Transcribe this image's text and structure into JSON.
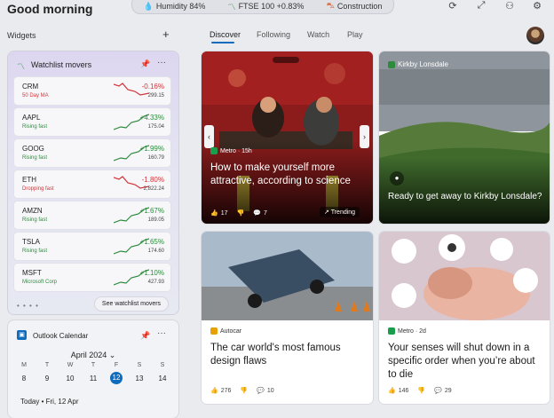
{
  "greeting": "Good morning",
  "ticker": [
    {
      "icon": "water-drop-icon",
      "label": "Humidity 84%"
    },
    {
      "icon": "trend-icon",
      "label": "FTSE 100 +0.83%"
    },
    {
      "icon": "construction-icon",
      "label": "Construction"
    }
  ],
  "widgets_label": "Widgets",
  "add_label": "+",
  "nav": [
    "Discover",
    "Following",
    "Watch",
    "Play"
  ],
  "watchlist": {
    "title": "Watchlist movers",
    "see_more": "See watchlist movers",
    "dots": "• • • •",
    "stocks": [
      {
        "symbol": "CRM",
        "sub": "50 Day MA",
        "change": "-0.16%",
        "price": "299.15",
        "trend": "down"
      },
      {
        "symbol": "AAPL",
        "sub": "Rising fast",
        "change": "+4.33%",
        "price": "175.04",
        "trend": "up"
      },
      {
        "symbol": "GOOG",
        "sub": "Rising fast",
        "change": "+1.99%",
        "price": "160.79",
        "trend": "up"
      },
      {
        "symbol": "ETH",
        "sub": "Dropping fast",
        "change": "-1.80%",
        "price": "2,822.24",
        "trend": "down"
      },
      {
        "symbol": "AMZN",
        "sub": "Rising fast",
        "change": "+1.67%",
        "price": "189.05",
        "trend": "up"
      },
      {
        "symbol": "TSLA",
        "sub": "Rising fast",
        "change": "+1.65%",
        "price": "174.60",
        "trend": "up"
      },
      {
        "symbol": "MSFT",
        "sub": "Microsoft Corp",
        "change": "+1.10%",
        "price": "427.93",
        "trend": "up"
      }
    ]
  },
  "calendar": {
    "title": "Outlook Calendar",
    "month": "April 2024",
    "days_of_week": [
      "M",
      "T",
      "W",
      "T",
      "F",
      "S",
      "S"
    ],
    "dates": [
      "8",
      "9",
      "10",
      "11",
      "12",
      "13",
      "14"
    ],
    "selected": "12",
    "today": "Today • Fri, 12 Apr"
  },
  "articles": [
    {
      "source": "Metro · 15h",
      "headline": "How to make yourself more attractive, according to science",
      "likes": "17",
      "comments": "7",
      "badge": "Trending"
    },
    {
      "source": "Kirkby Lonsdale",
      "headline": "Ready to get away to Kirkby Lonsdale?"
    },
    {
      "source": "Autocar",
      "headline": "The car world's most famous design flaws",
      "likes": "276",
      "comments": "10"
    },
    {
      "source": "Metro · 2d",
      "headline": "Your senses will shut down in a specific order when you’re about to die",
      "likes": "146",
      "comments": "29"
    }
  ],
  "colors": {
    "accent": "#0f6cbd",
    "up": "#2e8b3d",
    "down": "#d13438"
  }
}
